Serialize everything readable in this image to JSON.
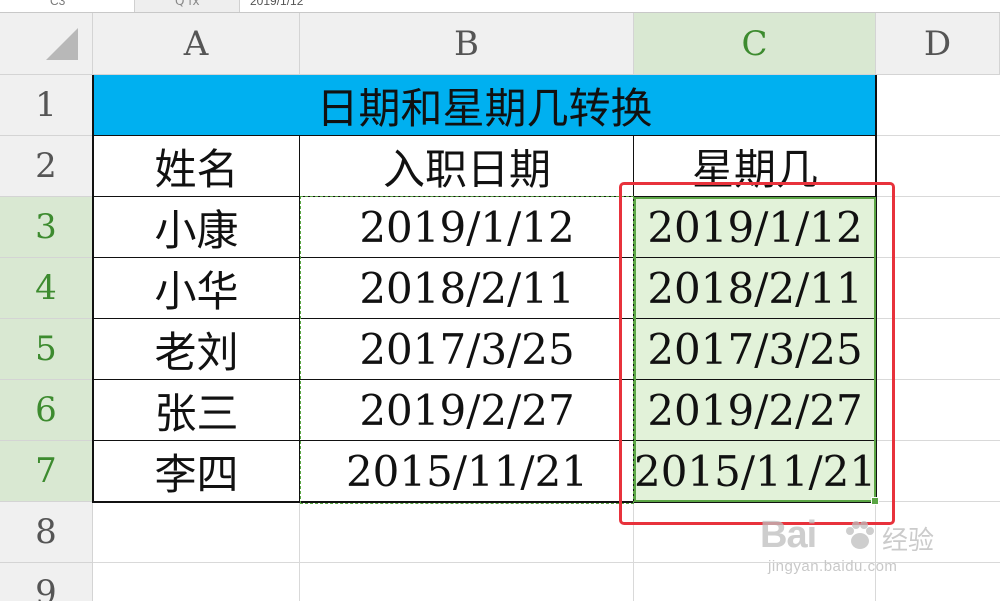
{
  "formula_bar": {
    "name_box": "C3",
    "icons": "Q fx",
    "value": "2019/1/12"
  },
  "columns": [
    "A",
    "B",
    "C",
    "D"
  ],
  "rows": [
    "1",
    "2",
    "3",
    "4",
    "5",
    "6",
    "7",
    "8",
    "9"
  ],
  "sheet": {
    "title": "日期和星期几转换",
    "headers": [
      "姓名",
      "入职日期",
      "星期几"
    ],
    "data": [
      {
        "name": "小康",
        "hire_date": "2019/1/12",
        "weekday": "2019/1/12"
      },
      {
        "name": "小华",
        "hire_date": "2018/2/11",
        "weekday": "2018/2/11"
      },
      {
        "name": "老刘",
        "hire_date": "2017/3/25",
        "weekday": "2017/3/25"
      },
      {
        "name": "张三",
        "hire_date": "2019/2/27",
        "weekday": "2019/2/27"
      },
      {
        "name": "李四",
        "hire_date": "2015/11/21",
        "weekday": "2015/11/21"
      }
    ]
  },
  "colors": {
    "title_fill": "#00b0f0",
    "selection_fill": "#e2f2d9",
    "selection_border": "#5aa544",
    "highlight_box": "#e8323c"
  },
  "watermark": {
    "brand": "Bai",
    "suffix": "经验",
    "url": "jingyan.baidu.com"
  }
}
